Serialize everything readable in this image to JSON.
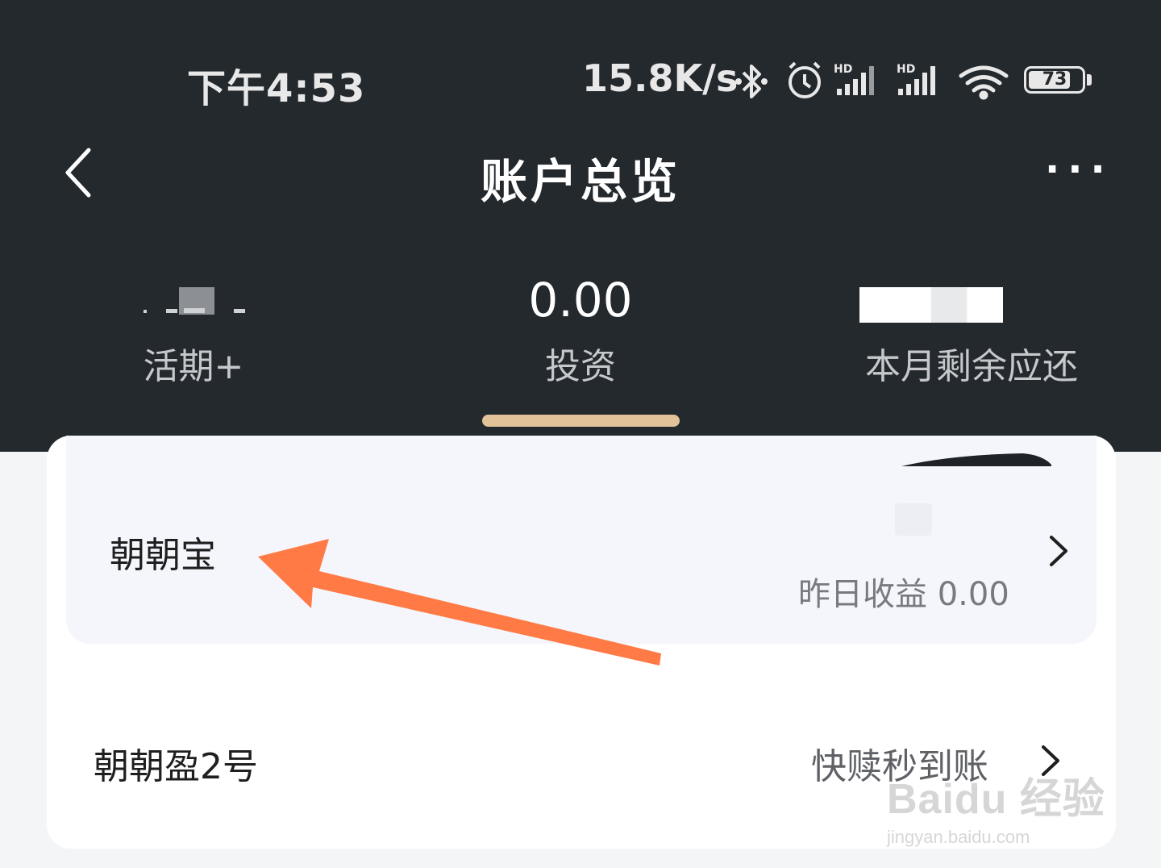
{
  "status_bar": {
    "time": "下午4:53",
    "speed": "15.8K/s",
    "battery": "73"
  },
  "nav": {
    "title": "账户总览",
    "more": "···"
  },
  "tabs": [
    {
      "amount": "",
      "label": "活期+"
    },
    {
      "amount": "0.00",
      "label": "投资"
    },
    {
      "amount": "",
      "label": "本月剩余应还"
    }
  ],
  "products": [
    {
      "name": "朝朝宝",
      "sub": "昨日收益 0.00"
    },
    {
      "name": "朝朝盈2号",
      "sub": "快赎秒到账"
    }
  ],
  "watermark": {
    "main": "Baidu 经验",
    "sub": "jingyan.baidu.com"
  },
  "colors": {
    "header_bg": "#24292e",
    "tab_indicator": "#e2c299",
    "annotation_arrow": "#ff7a45"
  }
}
